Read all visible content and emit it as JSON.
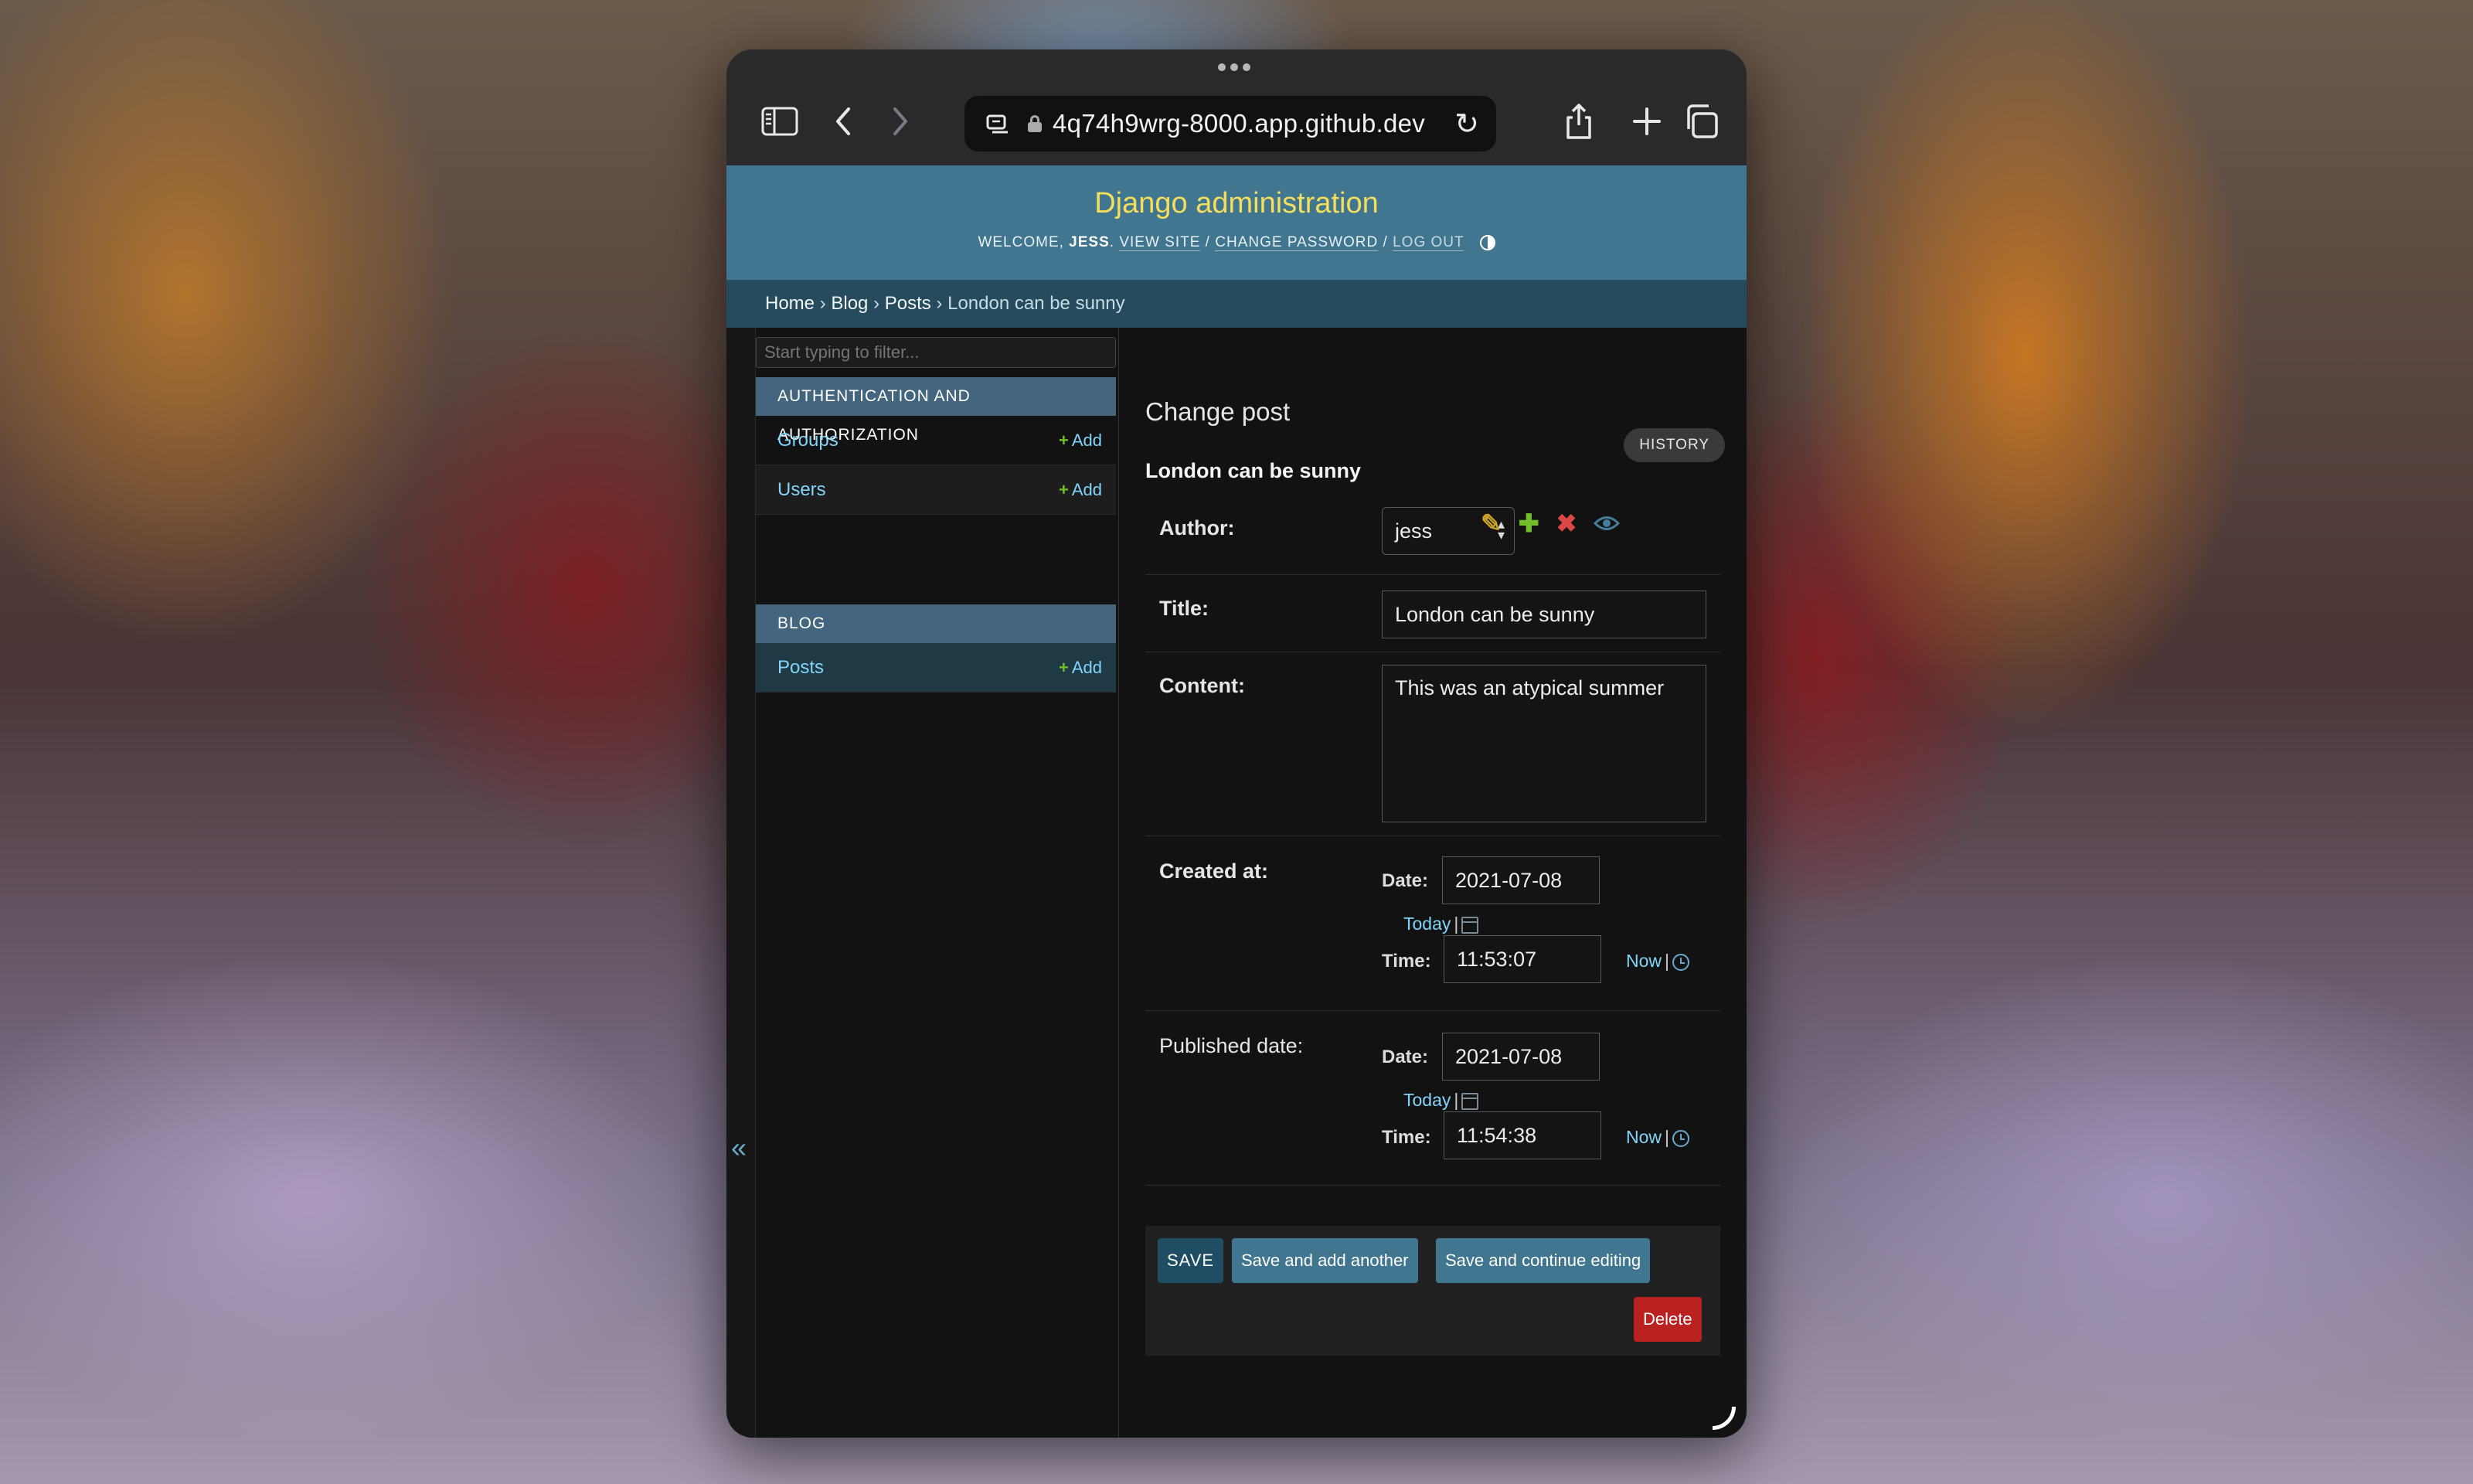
{
  "browser": {
    "url": "4q74h9wrg-8000.app.github.dev",
    "icons": {
      "sidebar": "sidebar-icon",
      "back": "back-icon",
      "forward": "forward-icon",
      "tabs": "tab-group-icon",
      "lock": "lock-icon",
      "reload": "reload-icon",
      "share": "share-icon",
      "new_tab": "plus-icon",
      "tab_overview": "tabs-overview-icon"
    }
  },
  "header": {
    "site_title": "Django administration",
    "welcome": "WELCOME,",
    "username": "JESS",
    "view_site": "VIEW SITE",
    "change_password": "CHANGE PASSWORD",
    "log_out": "LOG OUT"
  },
  "breadcrumbs": [
    "Home",
    "Blog",
    "Posts",
    "London can be sunny"
  ],
  "sidebar": {
    "filter_placeholder": "Start typing to filter...",
    "modules": [
      {
        "caption": "AUTHENTICATION AND AUTHORIZATION",
        "items": [
          {
            "label": "Groups",
            "add": "Add"
          },
          {
            "label": "Users",
            "add": "Add"
          }
        ]
      },
      {
        "caption": "BLOG",
        "items": [
          {
            "label": "Posts",
            "add": "Add"
          }
        ]
      }
    ],
    "collapse": "«"
  },
  "content": {
    "page_title": "Change post",
    "history": "HISTORY",
    "object_title": "London can be sunny",
    "fields": {
      "author": {
        "label": "Author:",
        "value": "jess"
      },
      "title": {
        "label": "Title:",
        "value": "London can be sunny"
      },
      "content": {
        "label": "Content:",
        "value": "This was an atypical summer"
      },
      "created_at": {
        "label": "Created at:",
        "date_label": "Date:",
        "date": "2021-07-08",
        "today": "Today",
        "time_label": "Time:",
        "time": "11:53:07",
        "now": "Now"
      },
      "published_date": {
        "label": "Published date:",
        "date_label": "Date:",
        "date": "2021-07-08",
        "today": "Today",
        "time_label": "Time:",
        "time": "11:54:38",
        "now": "Now"
      }
    },
    "buttons": {
      "save": "SAVE",
      "save_add_another": "Save and add another",
      "save_continue": "Save and continue editing",
      "delete": "Delete"
    }
  },
  "colors": {
    "header_bg": "#417690",
    "breadcrumbs_bg": "#264b5d",
    "site_title": "#f5dd5d",
    "link": "#81d4fa",
    "add_plus": "#70bf2b",
    "delete": "#ba2121"
  }
}
